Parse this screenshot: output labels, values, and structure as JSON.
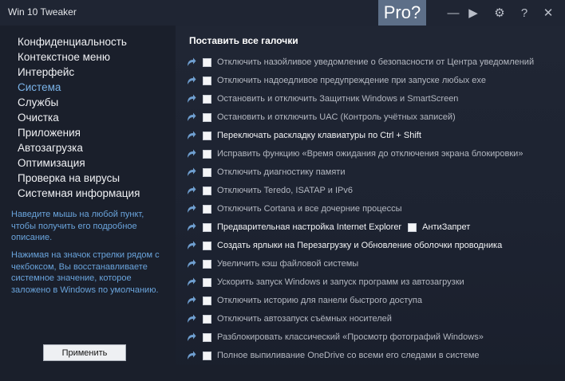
{
  "window": {
    "title": "Win 10 Tweaker",
    "pro_badge": "Pro?"
  },
  "titlebar_buttons": [
    {
      "name": "minimize-icon",
      "glyph": "—"
    },
    {
      "name": "play-icon",
      "glyph": "▶"
    },
    {
      "name": "gear-icon",
      "glyph": "⚙"
    },
    {
      "name": "help-icon",
      "glyph": "?"
    },
    {
      "name": "close-icon",
      "glyph": "✕"
    }
  ],
  "sidebar": {
    "items": [
      "Конфиденциальность",
      "Контекстное меню",
      "Интерфейс",
      "Система",
      "Службы",
      "Очистка",
      "Приложения",
      "Автозагрузка",
      "Оптимизация",
      "Проверка на вирусы",
      "Системная информация"
    ],
    "active_index": 3,
    "hint1": "Наведите мышь на любой пункт, чтобы получить его подробное описание.",
    "hint2": "Нажимая на значок стрелки рядом с чекбоксом, Вы восстанавливаете системное значение, которое заложено в Windows по умолчанию.",
    "apply_label": "Применить"
  },
  "main": {
    "select_all": "Поставить все галочки",
    "tweaks": [
      {
        "label": "Отключить назойливое уведомление о безопасности от Центра уведомлений",
        "white": false
      },
      {
        "label": "Отключить надоедливое предупреждение при запуске любых exe",
        "white": false
      },
      {
        "label": "Остановить и отключить Защитник Windows и SmartScreen",
        "white": false
      },
      {
        "label": "Остановить и отключить UAC (Контроль учётных записей)",
        "white": false
      },
      {
        "label": "Переключать раскладку клавиатуры по Ctrl + Shift",
        "white": true
      },
      {
        "label": "Исправить функцию «Время ожидания до отключения экрана блокировки»",
        "white": false
      },
      {
        "label": "Отключить диагностику памяти",
        "white": false
      },
      {
        "label": "Отключить Teredo, ISATAP и IPv6",
        "white": false
      },
      {
        "label": "Отключить Cortana и все дочерние процессы",
        "white": false
      },
      {
        "label": "Предварительная настройка Internet Explorer",
        "white": true,
        "extra": "АнтиЗапрет"
      },
      {
        "label": "Создать ярлыки на Перезагрузку и Обновление оболочки проводника",
        "white": true
      },
      {
        "label": "Увеличить кэш файловой системы",
        "white": false
      },
      {
        "label": "Ускорить запуск Windows и запуск программ из автозагрузки",
        "white": false
      },
      {
        "label": "Отключить историю для панели быстрого доступа",
        "white": false
      },
      {
        "label": "Отключить автозапуск съёмных носителей",
        "white": false
      },
      {
        "label": "Разблокировать классический «Просмотр фотографий Windows»",
        "white": false
      },
      {
        "label": "Полное выпиливание OneDrive со всеми его следами в системе",
        "white": false
      }
    ]
  },
  "colors": {
    "accent": "#7ab3e8",
    "hint": "#6aa4dc",
    "badge": "#5d6f88",
    "background": "#1d2230"
  }
}
